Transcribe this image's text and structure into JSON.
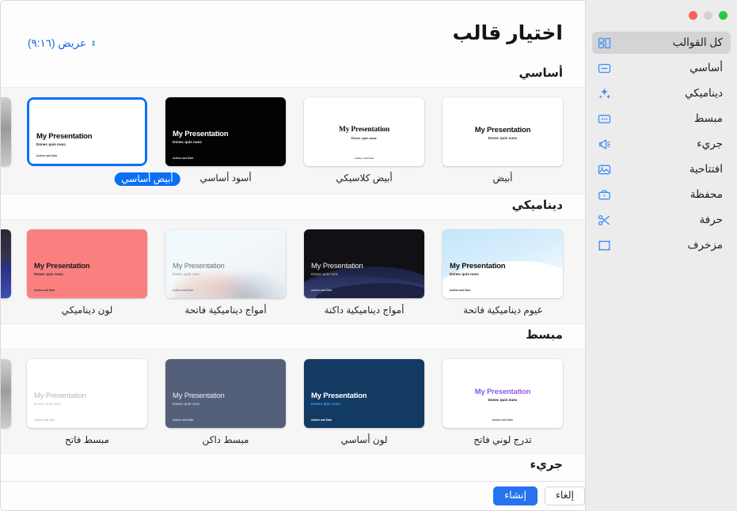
{
  "window": {
    "traffic_lights": [
      "green",
      "gray",
      "red"
    ]
  },
  "sidebar": {
    "items": [
      {
        "label": "كل القوالب",
        "icon": "grid-icon",
        "selected": true
      },
      {
        "label": "أساسي",
        "icon": "speech-bubble-icon",
        "selected": false
      },
      {
        "label": "ديناميكي",
        "icon": "sparkles-icon",
        "selected": false
      },
      {
        "label": "مبسط",
        "icon": "dots-rectangle-icon",
        "selected": false
      },
      {
        "label": "جريء",
        "icon": "megaphone-icon",
        "selected": false
      },
      {
        "label": "افتتاحية",
        "icon": "photo-icon",
        "selected": false
      },
      {
        "label": "محفظة",
        "icon": "briefcase-icon",
        "selected": false
      },
      {
        "label": "حرفة",
        "icon": "scissors-icon",
        "selected": false
      },
      {
        "label": "مزخرف",
        "icon": "frame-icon",
        "selected": false
      }
    ]
  },
  "header": {
    "title": "اختيار قالب",
    "size_picker": {
      "label": "عريض (٩:١٦)",
      "chevron": "⇕"
    }
  },
  "slide_text": {
    "title": "My Presentation",
    "subtitle": "Donec quis nunc",
    "footer": "Author and Date"
  },
  "sections": [
    {
      "heading": "أساسي",
      "templates": [
        {
          "caption": "أبيض",
          "style": "white",
          "selected": false
        },
        {
          "caption": "أبيض كلاسيكي",
          "style": "white-classic",
          "selected": false
        },
        {
          "caption": "أسود أساسي",
          "style": "black-basic",
          "selected": false
        },
        {
          "caption": "أبيض أساسي",
          "style": "white-basic",
          "selected": true
        }
      ]
    },
    {
      "heading": "ديناميكي",
      "templates": [
        {
          "caption": "غيوم ديناميكية فاتحة",
          "style": "clouds-light",
          "selected": false
        },
        {
          "caption": "أمواج ديناميكية داكنة",
          "style": "waves-dark",
          "selected": false
        },
        {
          "caption": "أمواج ديناميكية فاتحة",
          "style": "waves-light",
          "selected": false
        },
        {
          "caption": "لون ديناميكي",
          "style": "dynamic-color",
          "selected": false
        }
      ]
    },
    {
      "heading": "مبسط",
      "templates": [
        {
          "caption": "تدرج لوني فاتح",
          "style": "gradient-light",
          "selected": false
        },
        {
          "caption": "لون أساسي",
          "style": "navy-color",
          "selected": false
        },
        {
          "caption": "مبسط داكن",
          "style": "slate-dark",
          "selected": false
        },
        {
          "caption": "مبسط فاتح",
          "style": "simple-light",
          "selected": false
        }
      ]
    },
    {
      "heading": "جريء",
      "templates": []
    }
  ],
  "footer": {
    "create_label": "إنشاء",
    "cancel_label": "إلغاء"
  },
  "colors": {
    "accent": "#0a6ff5",
    "button_blue": "#2573ef",
    "link_blue": "#1668e3",
    "navy": "#123a63",
    "slate": "#54607a",
    "coral": "#fa8080",
    "sidebar_bg": "#ececed",
    "row_bg": "#f6f6f6"
  }
}
